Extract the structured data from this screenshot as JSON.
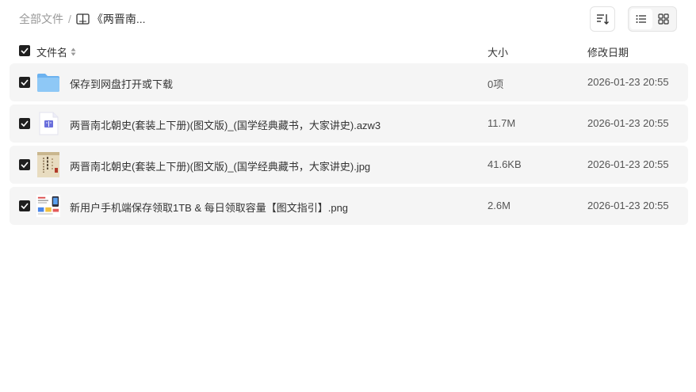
{
  "breadcrumb": {
    "root": "全部文件",
    "separator": "/",
    "current": "《两晋南..."
  },
  "toolbar": {
    "sort_icon": "sort-lines-icon",
    "view_list_icon": "list-view-icon",
    "view_grid_icon": "grid-view-icon"
  },
  "table": {
    "headers": {
      "name": "文件名",
      "size": "大小",
      "date": "修改日期"
    },
    "rows": [
      {
        "name": "保存到网盘打开或下载",
        "size": "0项",
        "date": "2026-01-23 20:55",
        "type": "folder",
        "checked": true
      },
      {
        "name": "两晋南北朝史(套装上下册)(图文版)_(国学经典藏书，大家讲史).azw3",
        "size": "11.7M",
        "date": "2026-01-23 20:55",
        "type": "ebook",
        "checked": true
      },
      {
        "name": "两晋南北朝史(套装上下册)(图文版)_(国学经典藏书，大家讲史).jpg",
        "size": "41.6KB",
        "date": "2026-01-23 20:55",
        "type": "image-cover",
        "checked": true
      },
      {
        "name": "新用户手机端保存领取1TB & 每日领取容量【图文指引】.png",
        "size": "2.6M",
        "date": "2026-01-23 20:55",
        "type": "image-screenshot",
        "checked": true
      }
    ]
  },
  "colors": {
    "row_bg": "#f5f5f5",
    "checkbox": "#1f1f1f",
    "folder": "#7bbcf2",
    "ebook_accent": "#6a6fdc"
  }
}
